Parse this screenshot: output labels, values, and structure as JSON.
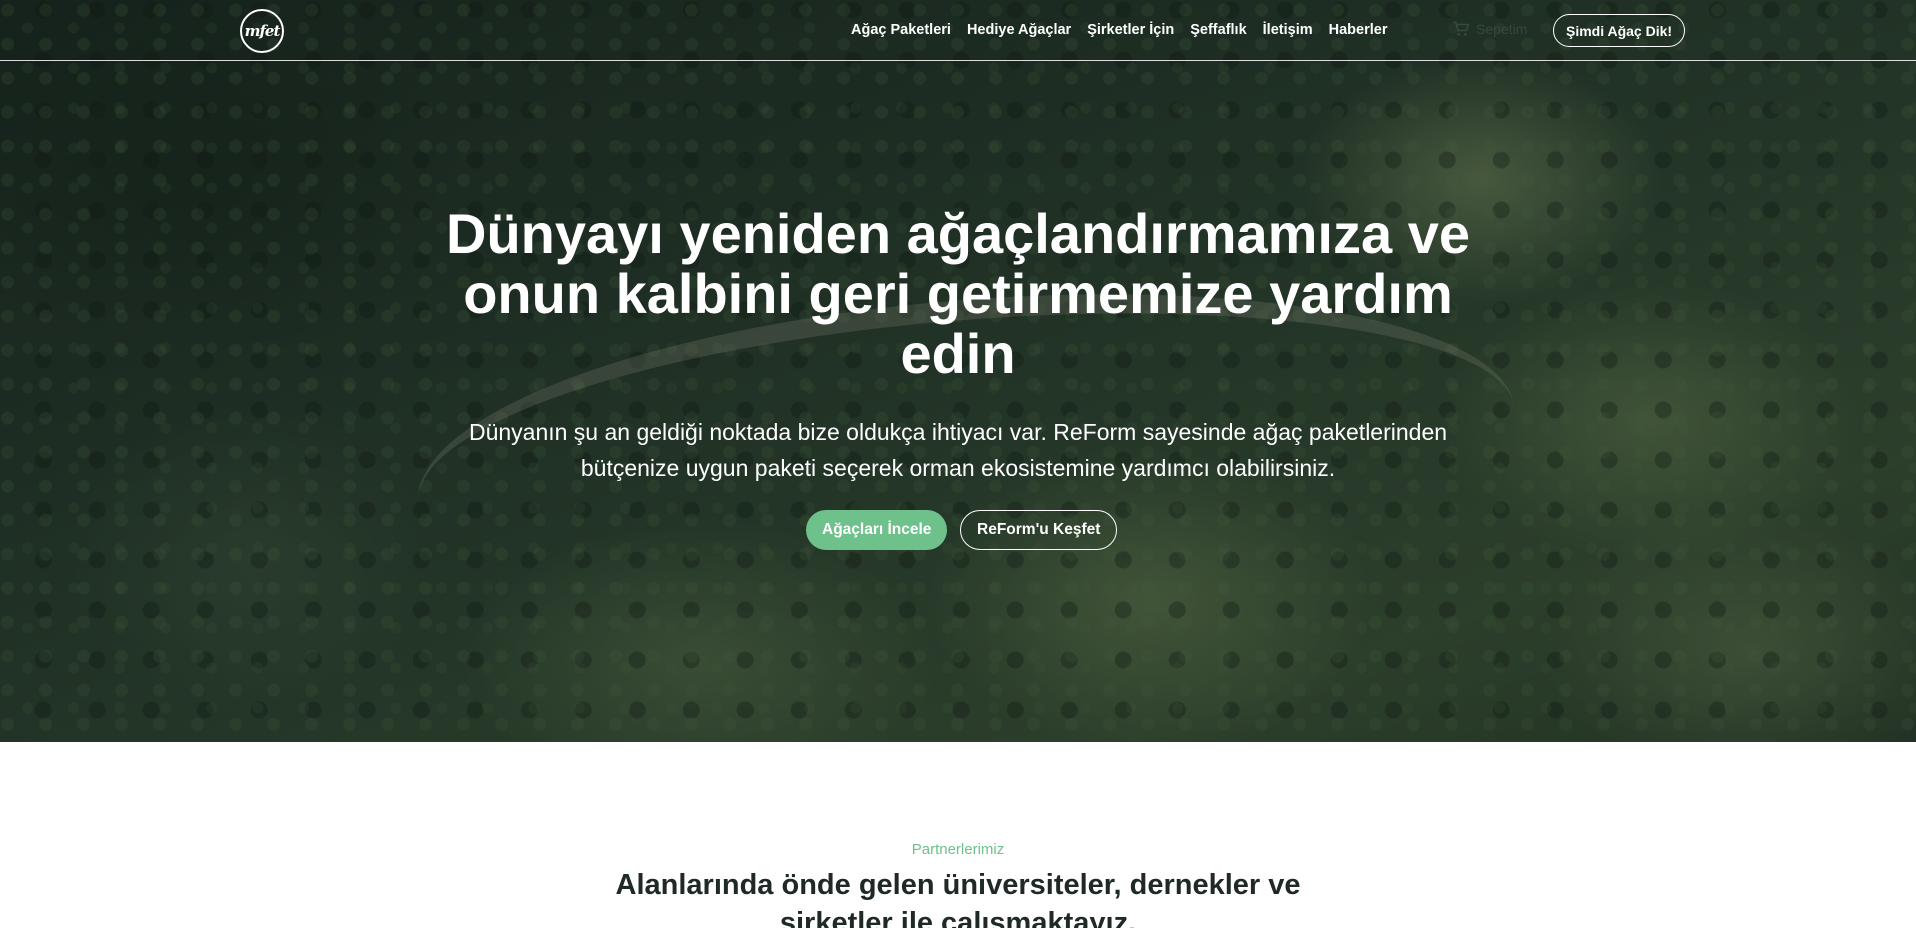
{
  "nav": {
    "logo_text": "mfet",
    "links": [
      "Ağaç Paketleri",
      "Hediye Ağaçlar",
      "Şirketler İçin",
      "Şeffaflık",
      "İletişim",
      "Haberler"
    ],
    "cart_label": "Sepetim",
    "cta_label": "Şimdi Ağaç Dik!"
  },
  "hero": {
    "title": "Dünyayı yeniden ağaçlandırmamıza ve onun kalbini geri getirmemize yardım edin",
    "subtitle": "Dünyanın şu an geldiği noktada bize oldukça ihtiyacı var. ReForm sayesinde ağaç paketlerinden bütçenize uygun paketi seçerek orman ekosistemine yardımcı olabilirsiniz.",
    "primary_button": "Ağaçları İncele",
    "secondary_button": "ReForm'u Keşfet"
  },
  "partners": {
    "kicker": "Partnerlerimiz",
    "title": "Alanlarında önde gelen üniversiteler, dernekler ve şirketler ile çalışmaktayız."
  },
  "colors": {
    "accent_green": "#6ec18b",
    "dark_text": "#1f2a24"
  },
  "icons": [
    "shopping-cart-icon"
  ]
}
